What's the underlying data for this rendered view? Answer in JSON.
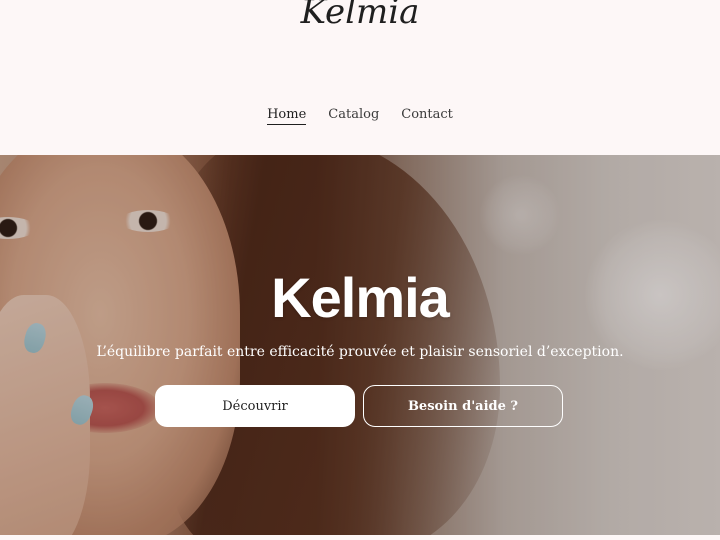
{
  "header": {
    "logo_text": "Kelmia",
    "nav": [
      {
        "label": "Home",
        "active": true
      },
      {
        "label": "Catalog",
        "active": false
      },
      {
        "label": "Contact",
        "active": false
      }
    ]
  },
  "hero": {
    "title": "Kelmia",
    "tagline": "L’équilibre parfait entre efficacité prouvée et plaisir sensoriel d’exception.",
    "primary_button": "Découvrir",
    "secondary_button": "Besoin d'aide ?"
  },
  "colors": {
    "header_bg": "#fdf7f7",
    "text_dark": "#1f1f1f",
    "button_primary_bg": "#ffffff",
    "hero_text": "#ffffff"
  }
}
